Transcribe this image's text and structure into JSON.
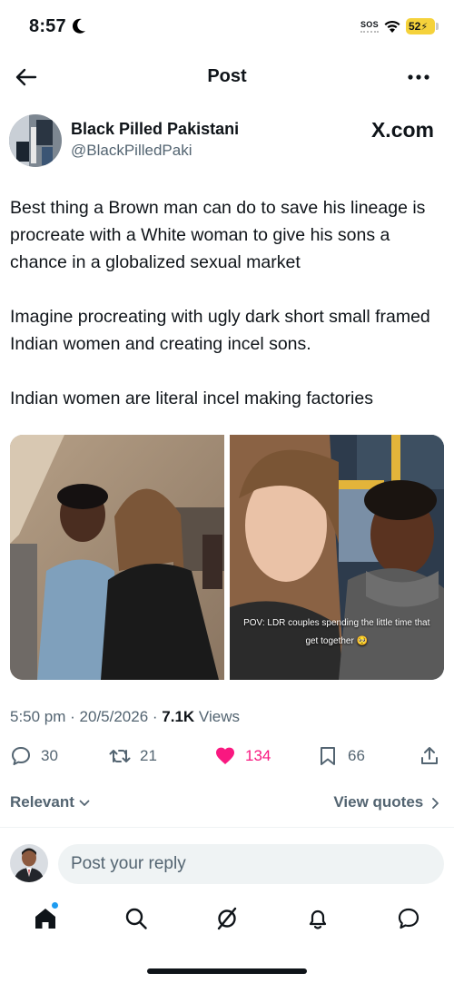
{
  "status_bar": {
    "time": "8:57",
    "sos": "SOS",
    "battery": "52"
  },
  "header": {
    "title": "Post"
  },
  "author": {
    "name": "Black Pilled Pakistani",
    "handle": "@BlackPilledPaki",
    "watermark": "X.com"
  },
  "post": {
    "paragraphs": [
      "Best thing a Brown man can do to save his lineage is procreate with a White woman to give his sons a chance in a globalized sexual market",
      "Imagine procreating with ugly dark short small framed Indian women and creating incel sons.",
      "Indian women are literal incel making factories"
    ],
    "media_caption": "POV: LDR couples spending the little time that get together 🥺",
    "timestamp": "5:50 pm · 20/5/2026 · ",
    "views_count": "7.1K",
    "views_label": " Views"
  },
  "engagement": {
    "replies": "30",
    "reposts": "21",
    "likes": "134",
    "bookmarks": "66",
    "like_color": "#f91880"
  },
  "replies_bar": {
    "sort_label": "Relevant",
    "view_quotes": "View quotes"
  },
  "reply": {
    "placeholder": "Post your reply"
  },
  "tabs": {
    "notification_dot_color": "#1d9bf0"
  }
}
